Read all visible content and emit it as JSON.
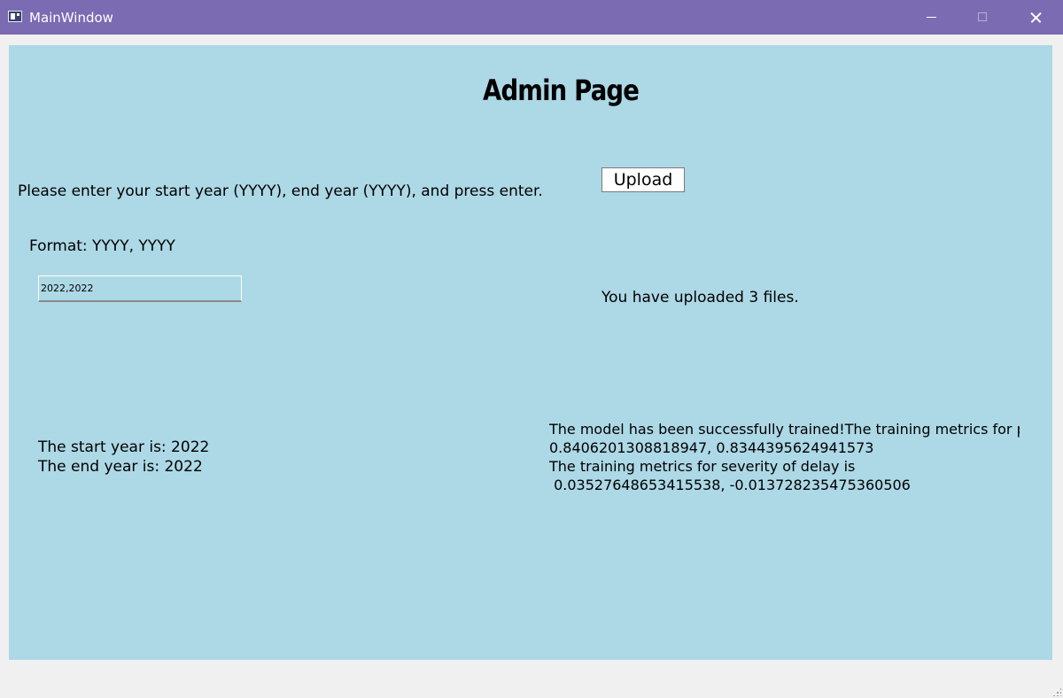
{
  "window": {
    "title": "MainWindow",
    "icons": {
      "app": "app-window-icon",
      "minimize": "minimize-icon",
      "maximize": "maximize-icon",
      "close": "close-icon"
    }
  },
  "colors": {
    "titlebar": "#7b6bb3",
    "content_background": "#add8e6",
    "window_background": "#f0f0f0"
  },
  "page": {
    "heading": "Admin Page",
    "instructions": "Please enter your start year (YYYY), end year (YYYY), and press enter.",
    "format_hint": "Format: YYYY, YYYY",
    "year_input": {
      "value": "2022,2022",
      "placeholder": ""
    },
    "start_year_text": "The start year is: 2022",
    "end_year_text": "The end year is: 2022",
    "upload_button": "Upload",
    "uploaded_text": "You have uploaded 3 files.",
    "training_result": {
      "line1": "The model has been successfully trained!The training metrics for probal",
      "line2": "0.8406201308818947, 0.8344395624941573",
      "line3": "The training metrics for severity of delay is",
      "line4": " 0.03527648653415538, -0.013728235475360506"
    }
  }
}
